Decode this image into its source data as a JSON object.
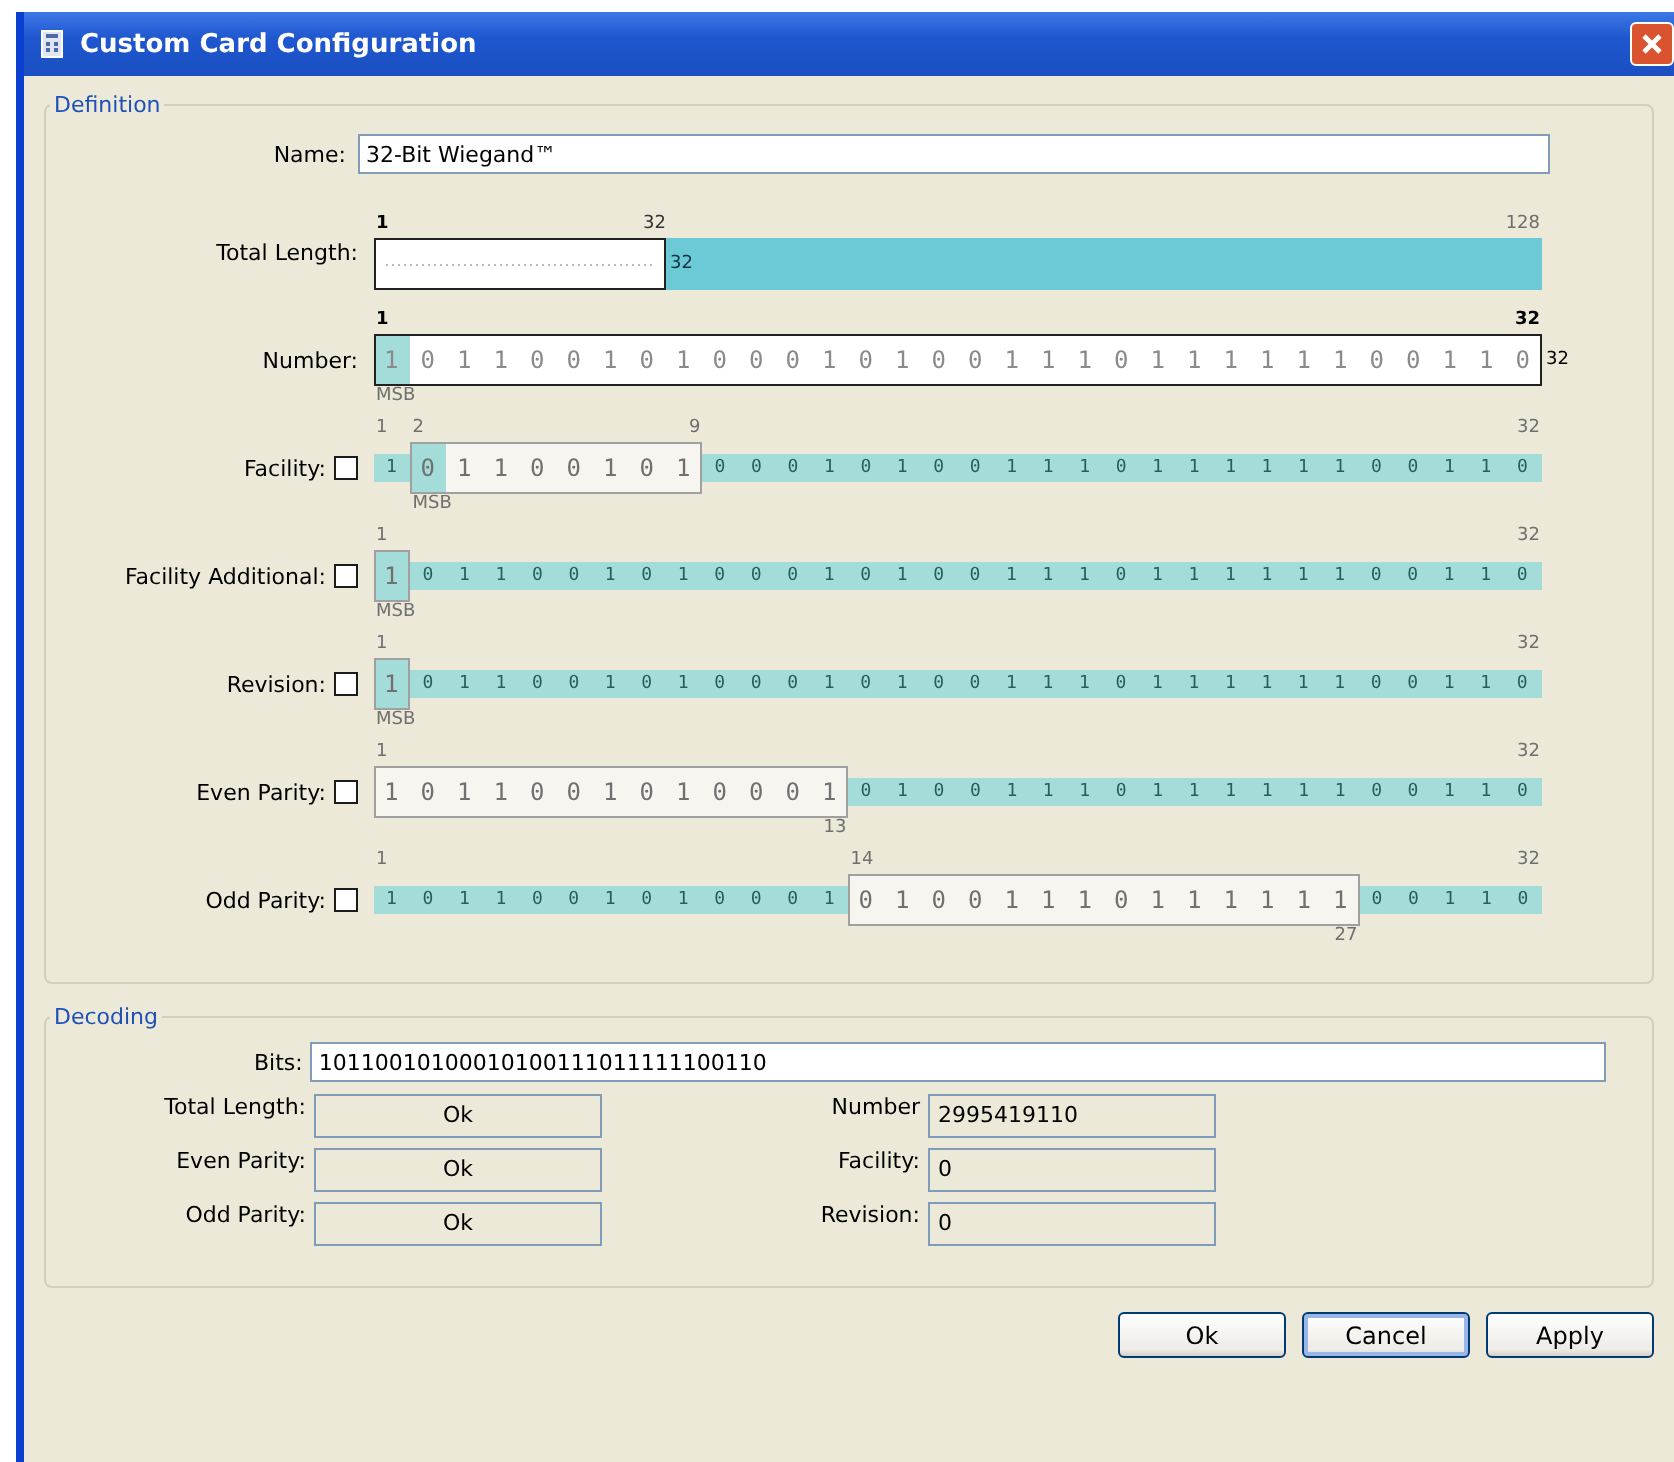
{
  "window": {
    "title": "Custom Card Configuration"
  },
  "definition": {
    "title": "Definition",
    "name_label": "Name:",
    "name_value": "32-Bit Wiegand™",
    "rows": [
      {
        "kind": "length",
        "label": "Total Length:",
        "enabled": true,
        "level": 0.25,
        "start_label": "1",
        "window_end_label": "32",
        "track_text": "32",
        "end_label": "128"
      },
      {
        "kind": "bits",
        "label": "Number:",
        "enabled": true,
        "after_label": "32",
        "segments": [
          {
            "kind": "window",
            "bits": "1 0 1 1 0 0 1 0 1 0 0 0 1 0 1 0 0 1 1 1 0 1 1 1 1 1 1 0 0 1 1 0",
            "msb": true,
            "top_start": "1",
            "top_end": "32",
            "bottom_start": "MSB"
          }
        ]
      },
      {
        "kind": "bits",
        "label": "Facility:",
        "checkbox": {
          "checked": false
        },
        "enabled": false,
        "segments": [
          {
            "kind": "track",
            "bits": "1",
            "top_start": "1"
          },
          {
            "kind": "window",
            "bits": "0 1 1 0 0 1 0 1",
            "msb": true,
            "top_start": "2",
            "top_end": "9",
            "bottom_start": "MSB"
          },
          {
            "kind": "track",
            "bits": "0 0 0 1 0 1 0 0 1 1 1 0 1 1 1 1 1 1 0 0 1 1 0",
            "top_end": "32"
          }
        ]
      },
      {
        "kind": "bits",
        "label": "Facility Additional:",
        "checkbox": {
          "checked": false
        },
        "enabled": false,
        "segments": [
          {
            "kind": "window",
            "bits": "1",
            "msb": true,
            "top_start": "1",
            "bottom_start": "MSB"
          },
          {
            "kind": "track",
            "bits": "0 1 1 0 0 1 0 1 0 0 0 1 0 1 0 0 1 1 1 0 1 1 1 1 1 1 0 0 1 1 0",
            "top_end": "32"
          }
        ]
      },
      {
        "kind": "bits",
        "label": "Revision:",
        "checkbox": {
          "checked": false
        },
        "enabled": false,
        "segments": [
          {
            "kind": "window",
            "bits": "1",
            "msb": true,
            "top_start": "1",
            "bottom_start": "MSB"
          },
          {
            "kind": "track",
            "bits": "0 1 1 0 0 1 0 1 0 0 0 1 0 1 0 0 1 1 1 0 1 1 1 1 1 1 0 0 1 1 0",
            "top_end": "32"
          }
        ]
      },
      {
        "kind": "bits",
        "label": "Even Parity:",
        "checkbox": {
          "checked": false
        },
        "enabled": false,
        "segments": [
          {
            "kind": "window",
            "bits": "1 0 1 1 0 0 1 0 1 0 0 0 1",
            "msb": false,
            "top_start": "1",
            "bottom_end": "13"
          },
          {
            "kind": "track",
            "bits": "0 1 0 0 1 1 1 0 1 1 1 1 1 1 0 0 1 1 0",
            "top_end": "32"
          }
        ]
      },
      {
        "kind": "bits",
        "label": "Odd Parity:",
        "checkbox": {
          "checked": false
        },
        "enabled": false,
        "segments": [
          {
            "kind": "track",
            "bits": "1 0 1 1 0 0 1 0 1 0 0 0 1",
            "top_start": "1"
          },
          {
            "kind": "window",
            "bits": "0 1 0 0 1 1 1 0 1 1 1 1 1 1",
            "msb": false,
            "top_start": "14",
            "bottom_end": "27"
          },
          {
            "kind": "track",
            "bits": "0 0 1 1 0",
            "top_end": "32"
          }
        ]
      }
    ]
  },
  "decoding": {
    "title": "Decoding",
    "bits_label": "Bits:",
    "bits_value": "10110010100010100111011111100110",
    "checks": [
      {
        "label": "Total Length:",
        "value": "Ok"
      },
      {
        "label": "Even Parity:",
        "value": "Ok"
      },
      {
        "label": "Odd Parity:",
        "value": "Ok"
      }
    ],
    "values": [
      {
        "label": "Number",
        "value": "2995419110"
      },
      {
        "label": "Facility:",
        "value": "0"
      },
      {
        "label": "Revision:",
        "value": "0"
      }
    ]
  },
  "buttons": [
    {
      "label": "Ok",
      "focused": false
    },
    {
      "label": "Cancel",
      "focused": true
    },
    {
      "label": "Apply",
      "focused": false
    }
  ]
}
